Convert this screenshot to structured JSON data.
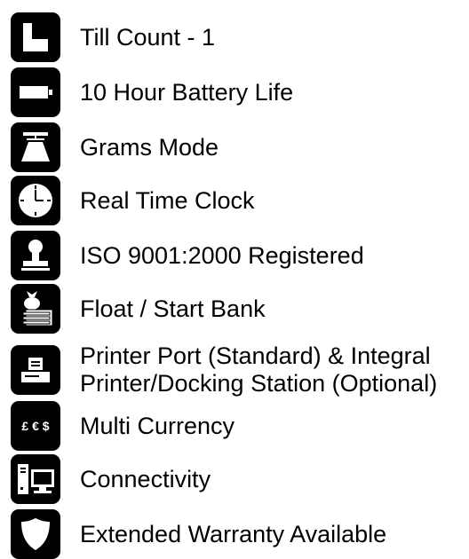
{
  "features": [
    {
      "icon": "till-count-icon",
      "label": "Till Count - 1"
    },
    {
      "icon": "battery-icon",
      "label": "10 Hour Battery Life"
    },
    {
      "icon": "scale-icon",
      "label": "Grams Mode"
    },
    {
      "icon": "clock-icon",
      "label": "Real Time Clock"
    },
    {
      "icon": "iso-stamp-icon",
      "label": "ISO 9001:2000 Registered"
    },
    {
      "icon": "money-bag-icon",
      "label": "Float / Start Bank"
    },
    {
      "icon": "printer-icon",
      "label_line1": "Printer Port (Standard) & Integral",
      "label_line2": "Printer/Docking Station (Optional)"
    },
    {
      "icon": "currency-icon",
      "label": "Multi Currency",
      "symbols": "£ € $"
    },
    {
      "icon": "computer-icon",
      "label": "Connectivity"
    },
    {
      "icon": "shield-icon",
      "label": "Extended Warranty Available"
    }
  ]
}
